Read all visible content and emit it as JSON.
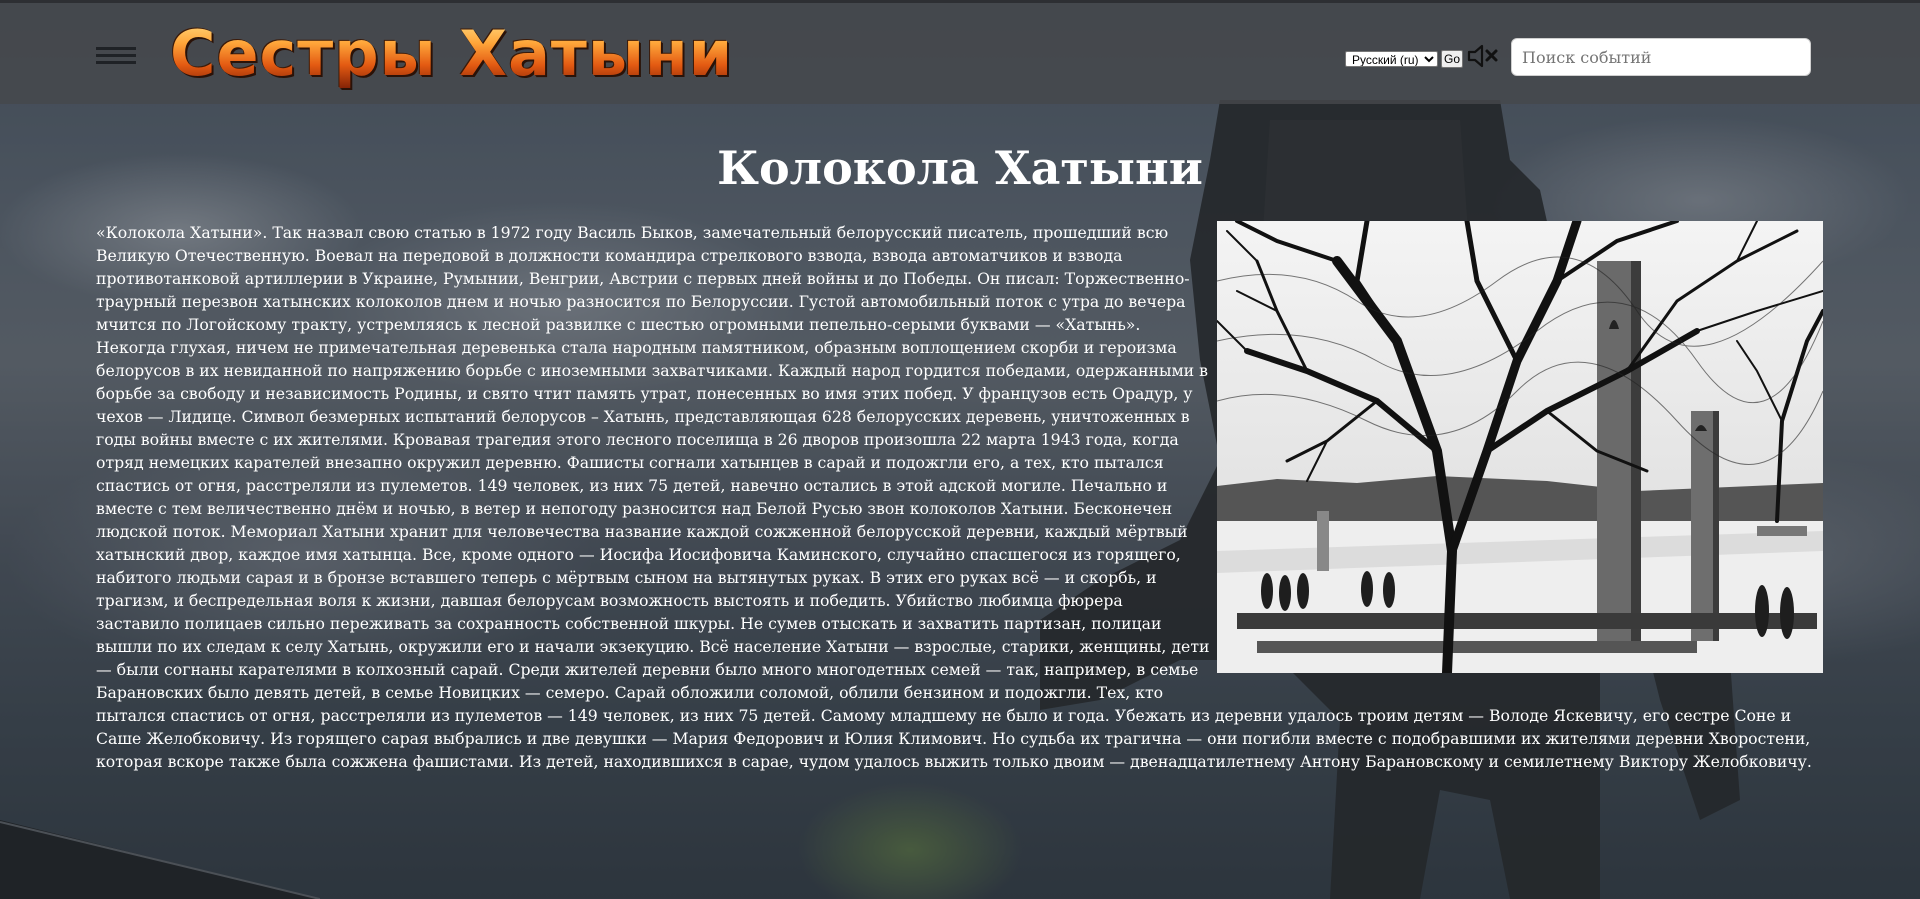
{
  "header": {
    "logo_text": "Сестры Хатыни",
    "language_selected": "Русский (ru)",
    "go_label": "Go",
    "search_placeholder": "Поиск событий",
    "icons": {
      "menu": "hamburger-menu-icon",
      "sound": "speaker-muted-icon"
    }
  },
  "article": {
    "title": "Колокола Хатыни",
    "body": "«Колокола Хатыни». Так назвал свою статью в 1972 году Василь Быков, замечательный белорусский писатель, прошедший всю Великую Отечественную. Воевал на передовой в должности командира стрелкового взвода, взвода автоматчиков и взвода противотанковой артиллерии в Украине, Румынии, Венгрии, Австрии с первых дней войны и до Победы. Он писал: Торжественно-траурный перезвон хатынских колоколов днем и ночью разносится по Белоруссии. Густой автомобильный поток с утра до вечера мчится по Логойскому тракту, устремляясь к лесной развилке с шестью огромными пепельно-серыми буквами — «Хатынь». Некогда глухая, ничем не примечательная деревенька стала народным памятником, образным воплощением скорби и героизма белорусов в их невиданной по напряжению борьбе с иноземными захватчиками. Каждый народ гордится победами, одержанными в борьбе за свободу и независимость Родины, и свято чтит память утрат, понесенных во имя этих побед. У французов есть Орадур, у чехов — Лидице. Символ безмерных испытаний белорусов – Хатынь, представляющая 628 белорусских деревень, уничтоженных в годы войны вместе с их жителями. Кровавая трагедия этого лесного поселища в 26 дворов произошла 22 марта 1943 года, когда отряд немецких карателей внезапно окружил деревню. Фашисты согнали хатынцев в сарай и подожгли его, а тех, кто пытался спастись от огня, расстреляли из пулеметов. 149 человек, из них 75 детей, навечно остались в этой адской могиле. Печально и вместе с тем величественно днём и ночью, в ветер и непогоду разносится над Белой Русью звон колоколов Хатыни. Бесконечен людской поток. Мемориал Хатыни хранит для человечества название каждой сожженной белорусской деревни, каждый мёртвый хатынский двор, каждое имя хатынца. Все, кроме одного — Иосифа Иосифовича Каминского, случайно спасшегося из горящего, набитого людьми сарая и в бронзе вставшего теперь с мёртвым сыном на вытянутых руках. В этих его руках всё — и скорбь, и трагизм, и беспредельная воля к жизни, давшая белорусам возможность выстоять и победить. Убийство любимца фюрера заставило полицаев сильно переживать за сохранность собственной шкуры. Не сумев отыскать и захватить партизан, полицаи вышли по их следам к селу Хатынь, окружили его и начали экзекуцию. Всё население Хатыни — взрослые, старики, женщины, дети — были согнаны карателями в колхозный сарай. Среди жителей деревни было много многодетных семей — так, например, в семье Барановских было девять детей, в семье Новицких — семеро. Сарай обложили соломой, облили бензином и подожгли. Тех, кто пытался спастись от огня, расстреляли из пулеметов — 149 человек, из них 75 детей. Самому младшему не было и года. Убежать из деревни удалось троим детям — Володе Яскевичу, его сестре Соне и Саше Желобковичу. Из горящего сарая выбрались и две девушки — Мария Федорович и Юлия Климович. Но судьба их трагична — они погибли вместе с подобравшими их жителями деревни Хворостени, которая вскоре также была сожжена фашистами. Из детей, находившихся в сарае, чудом удалось выжить только двоим — двенадцатилетнему Антону Барановскому и семилетнему Виктору Желобковичу."
  },
  "photo": {
    "name": "khatyn-memorial-bells-photo"
  },
  "colors": {
    "header_bg": "#464a4e",
    "text": "#ffffff",
    "logo_fire": "#ff9a2a"
  }
}
